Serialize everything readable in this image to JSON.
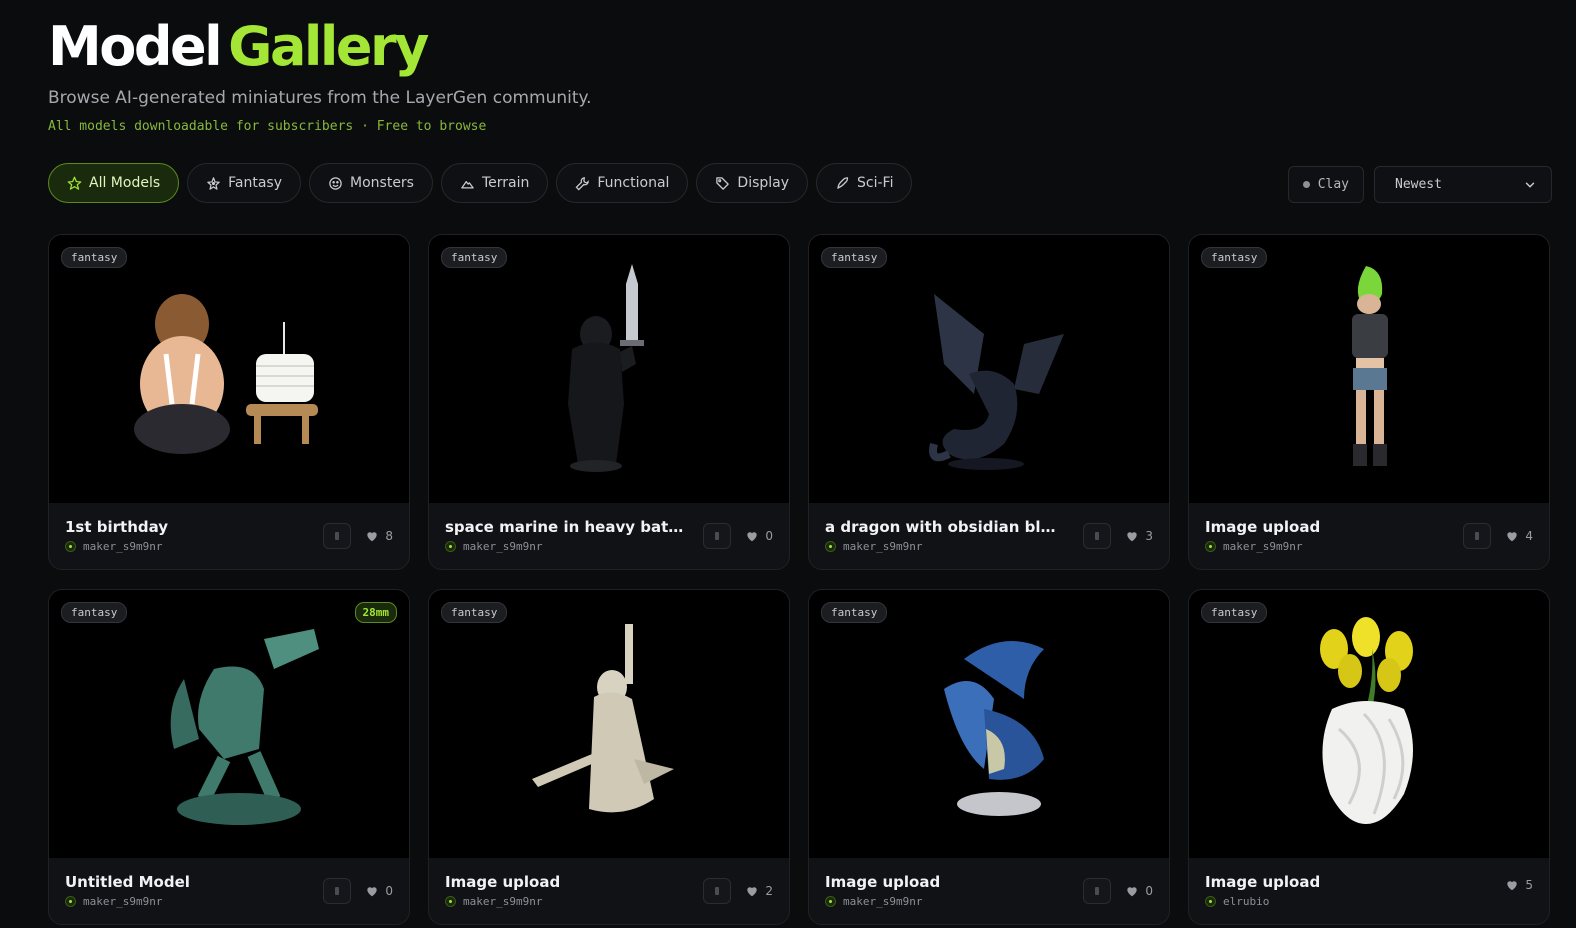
{
  "header": {
    "title_part1": "Model",
    "title_part2": "Gallery",
    "subtitle": "Browse AI-generated miniatures from the LayerGen community.",
    "tagline": "All models downloadable for subscribers · Free to browse"
  },
  "filters": [
    {
      "label": "All Models",
      "icon": "star-icon",
      "active": true
    },
    {
      "label": "Fantasy",
      "icon": "sparkle-star-icon",
      "active": false
    },
    {
      "label": "Monsters",
      "icon": "smiley-face-icon",
      "active": false
    },
    {
      "label": "Terrain",
      "icon": "mountain-icon",
      "active": false
    },
    {
      "label": "Functional",
      "icon": "wrench-icon",
      "active": false
    },
    {
      "label": "Display",
      "icon": "tag-icon",
      "active": false
    },
    {
      "label": "Sci-Fi",
      "icon": "rocket-icon",
      "active": false
    }
  ],
  "controls": {
    "clay_label": "Clay",
    "sort_value": "Newest"
  },
  "models": [
    {
      "category": "fantasy",
      "name": "1st birthday",
      "author": "maker_s9m9nr",
      "likes": "8",
      "has_download": true,
      "size": ""
    },
    {
      "category": "fantasy",
      "name": "space marine in heavy battle-wo...",
      "author": "maker_s9m9nr",
      "likes": "0",
      "has_download": true,
      "size": ""
    },
    {
      "category": "fantasy",
      "name": "a dragon with obsidian black sca...",
      "author": "maker_s9m9nr",
      "likes": "3",
      "has_download": true,
      "size": ""
    },
    {
      "category": "fantasy",
      "name": "Image upload",
      "author": "maker_s9m9nr",
      "likes": "4",
      "has_download": true,
      "size": ""
    },
    {
      "category": "fantasy",
      "name": "Untitled Model",
      "author": "maker_s9m9nr",
      "likes": "0",
      "has_download": true,
      "size": "28mm"
    },
    {
      "category": "fantasy",
      "name": "Image upload",
      "author": "maker_s9m9nr",
      "likes": "2",
      "has_download": true,
      "size": ""
    },
    {
      "category": "fantasy",
      "name": "Image upload",
      "author": "maker_s9m9nr",
      "likes": "0",
      "has_download": true,
      "size": ""
    },
    {
      "category": "fantasy",
      "name": "Image upload",
      "author": "elrubio",
      "likes": "5",
      "has_download": false,
      "size": ""
    }
  ]
}
